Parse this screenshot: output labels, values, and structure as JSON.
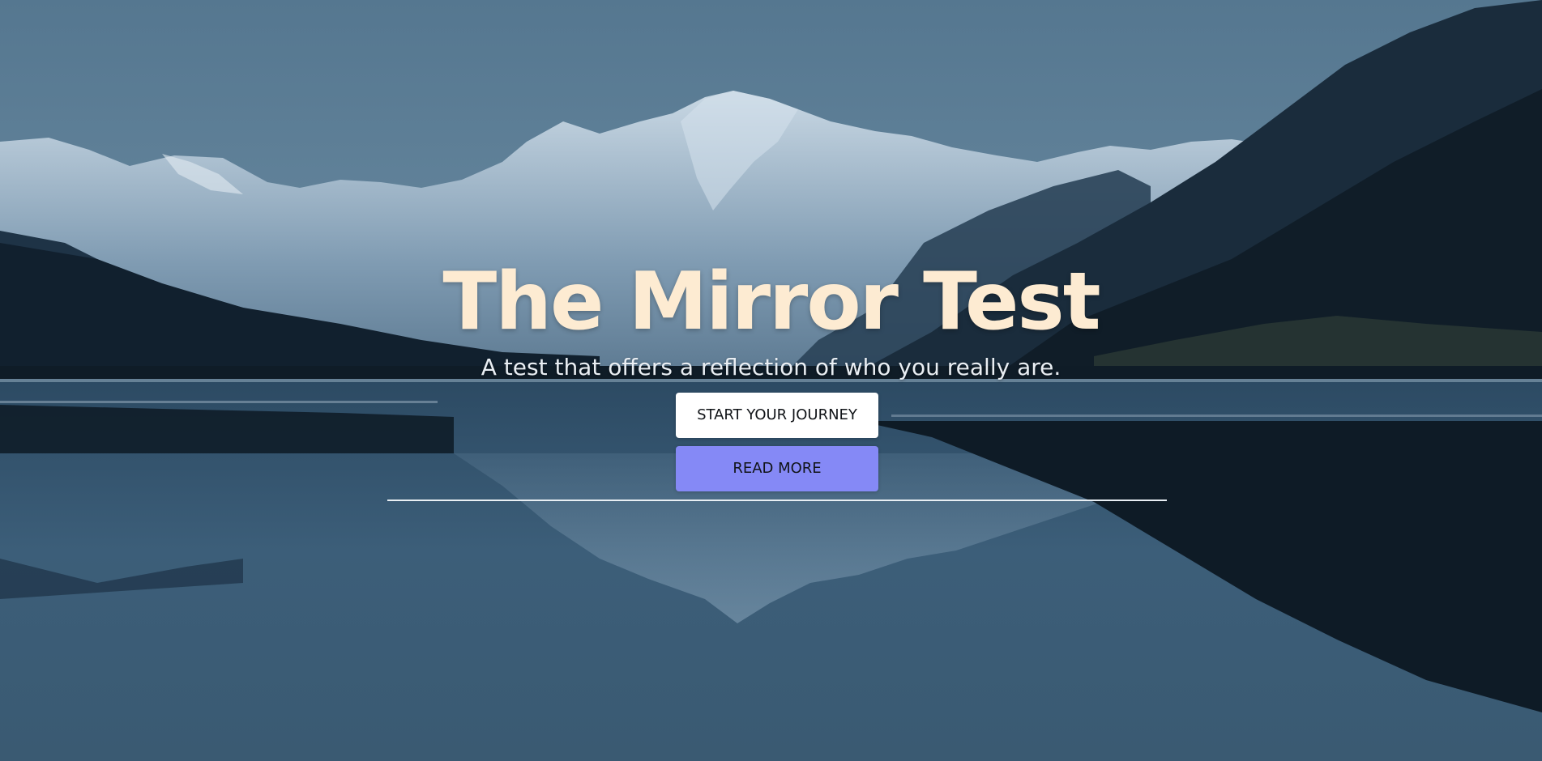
{
  "hero": {
    "title": "The Mirror Test",
    "subtitle": "A test that offers a reflection of who you really are."
  },
  "buttons": {
    "start_label": "START YOUR JOURNEY",
    "read_more_label": "READ MORE"
  },
  "colors": {
    "title": "#fdebd2",
    "primary_button_bg": "#ffffff",
    "secondary_button_bg": "#8589f6",
    "sky": "#5a7b94",
    "water": "#3a5a74"
  }
}
